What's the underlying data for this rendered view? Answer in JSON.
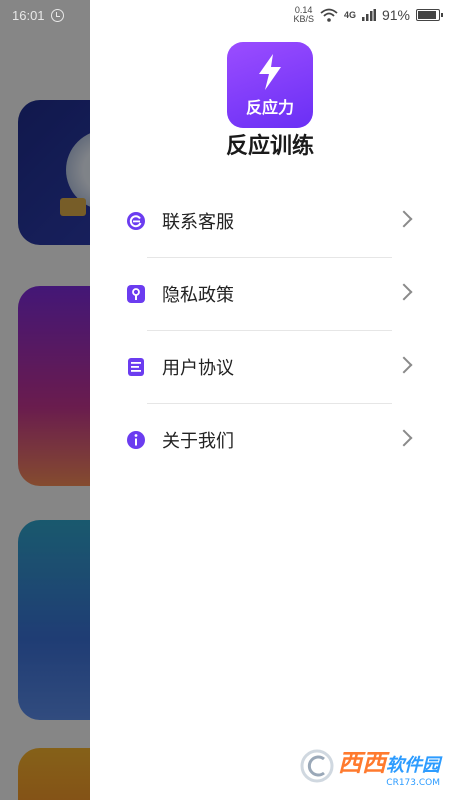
{
  "status_bar": {
    "time": "16:01",
    "net_speed_value": "0.14",
    "net_speed_unit": "KB/S",
    "network": "4G",
    "battery_percent": "91%",
    "battery_level": 0.91
  },
  "drawer": {
    "logo_text": "反应力",
    "app_name": "反应训练",
    "menu": [
      {
        "label": "联系客服",
        "icon": "customer-service-icon"
      },
      {
        "label": "隐私政策",
        "icon": "privacy-icon"
      },
      {
        "label": "用户协议",
        "icon": "agreement-icon"
      },
      {
        "label": "关于我们",
        "icon": "info-icon"
      }
    ]
  },
  "watermark": {
    "brand": "西西",
    "brand2": "软件园",
    "url": "CR173.COM"
  },
  "colors": {
    "accent": "#7b3cff",
    "overlay": "rgba(0,0,0,0.45)"
  }
}
